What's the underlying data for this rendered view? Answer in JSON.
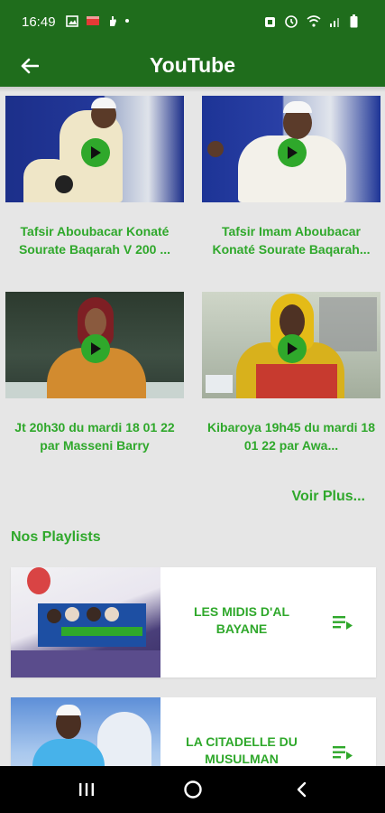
{
  "status": {
    "time": "16:49",
    "left_icons": [
      "image-icon",
      "flag-icon",
      "hand-icon",
      "dot-icon"
    ],
    "right_icons": [
      "alarm-icon",
      "clock-icon",
      "wifi-icon",
      "signal-icon",
      "battery-icon"
    ]
  },
  "appbar": {
    "title": "YouTube",
    "back_icon": "arrow-left-icon"
  },
  "colors": {
    "primary": "#1f6d1c",
    "accent": "#2fa82b",
    "background": "#e6e6e6"
  },
  "videos": [
    {
      "title": "Tafsir Aboubacar Konaté Sourate Baqarah V 200 ..."
    },
    {
      "title": "Tafsir Imam Aboubacar Konaté Sourate Baqarah..."
    },
    {
      "title": "Jt 20h30 du mardi 18 01 22 par Masseni Barry"
    },
    {
      "title": "Kibaroya 19h45 du mardi 18 01 22 par Awa..."
    }
  ],
  "voir_plus": "Voir Plus...",
  "playlists_section": {
    "title": "Nos Playlists"
  },
  "playlists": [
    {
      "title": "LES MIDIS D'AL BAYANE",
      "icon": "playlist-play-icon"
    },
    {
      "title": "LA CITADELLE DU MUSULMAN",
      "icon": "playlist-play-icon"
    }
  ],
  "navbar": {
    "recents_icon": "recents-icon",
    "home_icon": "home-circle-icon",
    "back_icon": "nav-back-icon"
  }
}
